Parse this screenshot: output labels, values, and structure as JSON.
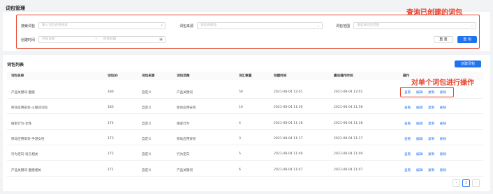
{
  "page_title": "词包管理",
  "annotations": {
    "search": "查询已创建的词包",
    "ops": "对单个词包进行操作"
  },
  "search": {
    "keyword_label": "搜索词包",
    "keyword_placeholder": "输入词包名称搜索",
    "source_label": "词包来源",
    "source_placeholder": "请选择来源",
    "scope_label": "词包范围",
    "scope_placeholder": "请选择词包范围",
    "created_label": "创建时间",
    "start_placeholder": "开始日期",
    "range_sep": "~",
    "end_placeholder": "结束日期",
    "reset": "重 置",
    "query": "查 询"
  },
  "list": {
    "title": "词包列表",
    "create_button": "创建词包",
    "columns": [
      "词包名称",
      "词包ID",
      "词包来源",
      "词包范围",
      "词汇数量",
      "创建时间",
      "最后操作时间",
      "操作"
    ],
    "rows": [
      [
        "产品关键词-面膜",
        "186",
        "自定义",
        "产品关键词",
        "50",
        "2021-08-04 12:01",
        "2021-08-04 12:01"
      ],
      [
        "移动应用安装-火腿词词包",
        "185",
        "自定义",
        "移动应用安装",
        "10",
        "2021-08-04 11:56",
        "2021-08-04 11:56"
      ],
      [
        "搜索行为-女性",
        "174",
        "自定义",
        "搜索行为",
        "4",
        "2021-08-04 11:18",
        "2021-08-04 11:18"
      ],
      [
        "移动应用安装-手游女性",
        "173",
        "自定义",
        "移动应用安装",
        "3",
        "2021-08-04 11:17",
        "2021-08-04 11:17"
      ],
      [
        "行为定向-语言相关",
        "172",
        "自定义",
        "行为定向",
        "5",
        "2021-08-04 11:09",
        "2021-08-04 11:09"
      ],
      [
        "产品关键词-面膜相关",
        "171",
        "自定义",
        "产品关键词",
        "6",
        "2021-08-04 11:07",
        "2021-08-04 11:07"
      ]
    ],
    "ops": [
      "查看",
      "编辑",
      "复制",
      "删除"
    ]
  },
  "pager": {
    "prev": "‹",
    "current": "1",
    "next": "›"
  },
  "colors": {
    "accent": "#1f72f0",
    "annotation": "#e8432e"
  }
}
